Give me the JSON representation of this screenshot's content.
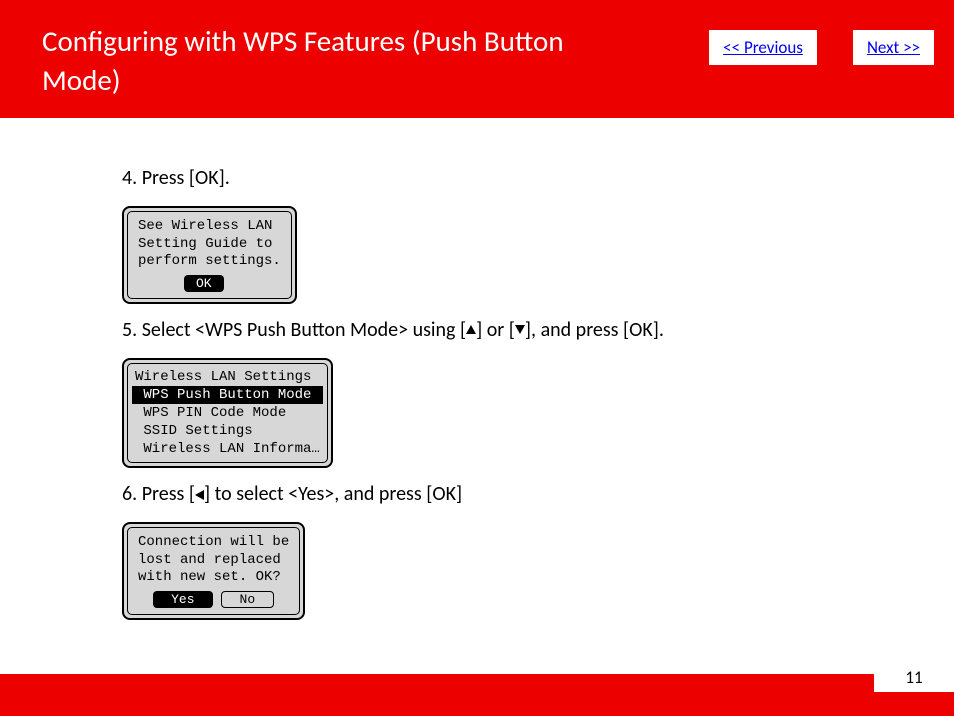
{
  "header": {
    "title": "Configuring with WPS Features (Push Button Mode)"
  },
  "nav": {
    "previous": "<< Previous",
    "next": "Next >>"
  },
  "steps": {
    "s4": "4. Press [OK].",
    "s5_a": "5. Select <WPS Push Button Mode> using [",
    "s5_b": "] or [",
    "s5_c": "], and press [OK].",
    "s6_a": "6. Press [",
    "s6_b": "] to select <Yes>, and press [OK]"
  },
  "screen1": {
    "line1": "See Wireless LAN",
    "line2": "Setting Guide to",
    "line3": "perform settings.",
    "ok": "OK"
  },
  "screen2": {
    "item1": "Wireless LAN Settings",
    "item2": " WPS Push Button Mode",
    "item3": " WPS PIN Code Mode",
    "item4": " SSID Settings",
    "item5": " Wireless LAN Informa…"
  },
  "screen3": {
    "line1": "Connection will be",
    "line2": "lost and replaced",
    "line3": "with new set. OK?",
    "yes": "Yes",
    "no": "No"
  },
  "page": {
    "number": "11"
  }
}
